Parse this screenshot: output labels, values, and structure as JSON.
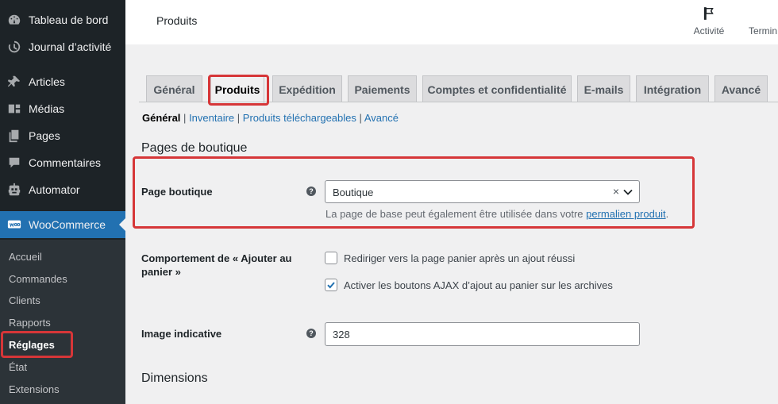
{
  "sidebar": {
    "items": [
      {
        "label": "Tableau de bord",
        "icon": "dashboard-icon"
      },
      {
        "label": "Journal d’activité",
        "icon": "history-icon"
      },
      {
        "label": "Articles",
        "icon": "pin-icon"
      },
      {
        "label": "Médias",
        "icon": "media-icon"
      },
      {
        "label": "Pages",
        "icon": "pages-icon"
      },
      {
        "label": "Commentaires",
        "icon": "comment-icon"
      },
      {
        "label": "Automator",
        "icon": "robot-icon"
      },
      {
        "label": "WooCommerce",
        "icon": "woo-icon"
      }
    ],
    "submenu": [
      "Accueil",
      "Commandes",
      "Clients",
      "Rapports",
      "Réglages",
      "État",
      "Extensions"
    ]
  },
  "header": {
    "title": "Produits",
    "activity_label": "Activité",
    "termin_label": "Termin"
  },
  "tabs": [
    "Général",
    "Produits",
    "Expédition",
    "Paiements",
    "Comptes et confidentialité",
    "E-mails",
    "Intégration",
    "Avancé"
  ],
  "subnav": {
    "items": [
      "Général",
      "Inventaire",
      "Produits téléchargeables",
      "Avancé"
    ],
    "sep": "|"
  },
  "section1": {
    "title": "Pages de boutique",
    "shop_page_label": "Page boutique",
    "shop_page_value": "Boutique",
    "clear_symbol": "×",
    "desc_text": "La page de base peut également être utilisée dans votre ",
    "desc_link": "permalien produit",
    "desc_end": ".",
    "add_to_cart_label": "Comportement de « Ajouter au panier »",
    "redirect_label": "Rediriger vers la page panier après un ajout réussi",
    "ajax_label": "Activer les boutons AJAX d’ajout au panier sur les archives",
    "placeholder_label": "Image indicative",
    "placeholder_value": "328",
    "help_symbol": "?"
  },
  "section2": {
    "title": "Dimensions"
  },
  "colors": {
    "accent": "#2271b1",
    "highlight": "#d63638",
    "sidebar_bg": "#1d2327"
  }
}
